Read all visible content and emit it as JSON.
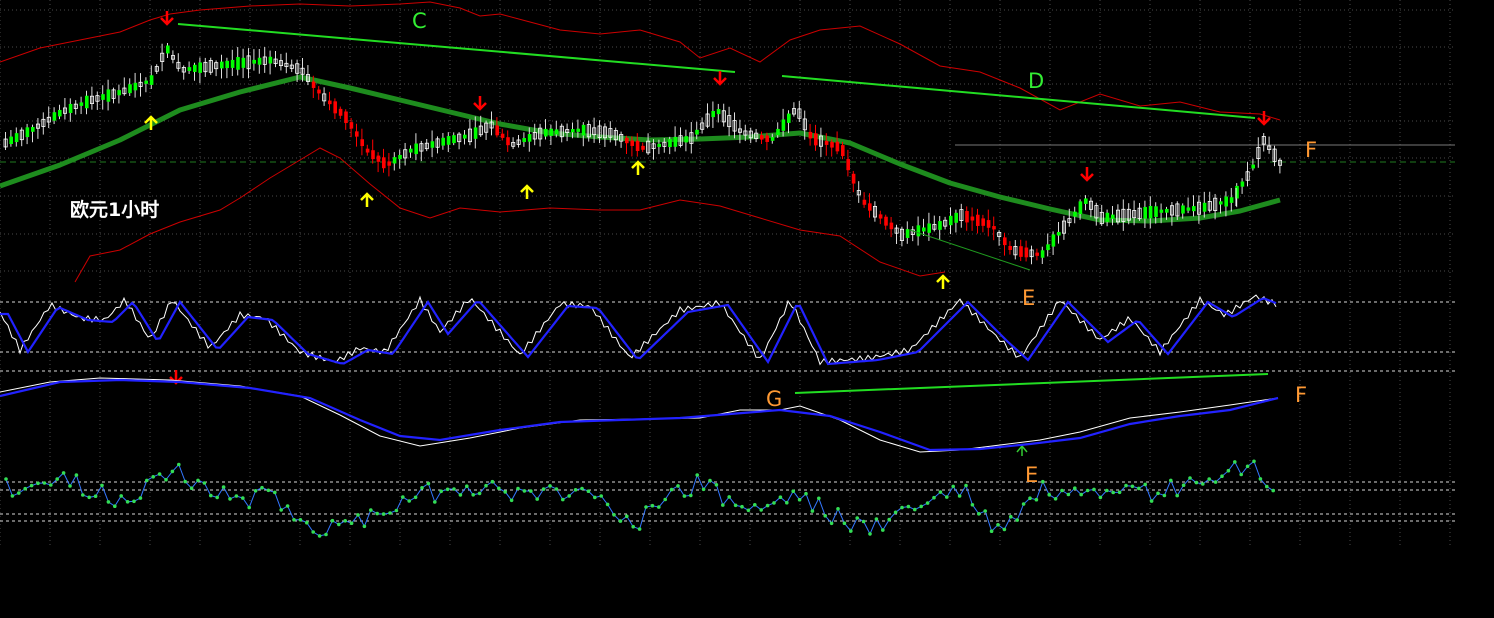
{
  "chart_data": {
    "type": "candlestick",
    "title": "欧元1小时",
    "colors": {
      "background": "#000000",
      "bull": "#00ff00",
      "bear": "#ff0000",
      "neutral_candle": "#ffffff",
      "ma": "#1e8c1e",
      "bands": "#cc0000",
      "trendline": "#22dd22",
      "arrow_down": "#ff0000",
      "arrow_up": "#ffff00",
      "label_green": "#33ee33",
      "label_orange": "#ff9933",
      "osc_main": "#ffffff",
      "osc_signal": "#2222ff",
      "osc3_line": "#3377ff",
      "osc3_dots": "#33dd55",
      "grid": "#4a4a4a",
      "guide": "#d9d9d9"
    },
    "annotations": [
      {
        "name": "label-c",
        "text": "C",
        "color": "label_green"
      },
      {
        "name": "label-d",
        "text": "D",
        "color": "label_green"
      },
      {
        "name": "label-f-main",
        "text": "F",
        "color": "label_orange"
      },
      {
        "name": "label-e-1",
        "text": "E",
        "color": "label_orange"
      },
      {
        "name": "label-g",
        "text": "G",
        "color": "label_orange"
      },
      {
        "name": "label-f-osc",
        "text": "F",
        "color": "label_orange"
      },
      {
        "name": "label-e-2",
        "text": "E",
        "color": "label_orange"
      }
    ]
  }
}
